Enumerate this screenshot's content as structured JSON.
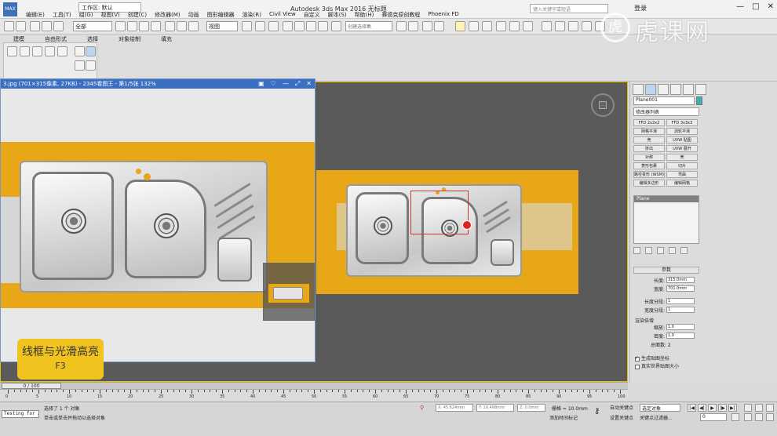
{
  "titlebar": {
    "workspace": "工作区: 默认",
    "title": "Autodesk 3ds Max 2016      无标题",
    "search_placeholder": "键入关键字或短语",
    "login": "登录",
    "menus": [
      "编辑(E)",
      "工具(T)",
      "组(G)",
      "视图(V)",
      "创建(C)",
      "修改器(M)",
      "动画",
      "图形编辑器",
      "渲染(R)",
      "Civil View",
      "自定义",
      "脚本(S)",
      "帮助(H)",
      "赛德克原创教程",
      "Phoenix FD"
    ],
    "window_buttons": [
      "—",
      "□",
      "✕"
    ],
    "app_icon_label": "MAX"
  },
  "toolbar": {
    "selection_filter": "全部",
    "reference_coord": "视图",
    "named_selection": "创建选择集"
  },
  "ribbon": {
    "tabs": [
      "建模",
      "自由形式",
      "选择",
      "对象绘制",
      "填充"
    ]
  },
  "watermark": {
    "text": "虎课网"
  },
  "image_viewer": {
    "title": "3.jpg  (701×315像素, 27KB) - 2345看图王 - 第1/5张 132%",
    "buttons": [
      "▣",
      "♡",
      "—",
      "⤢",
      "✕"
    ]
  },
  "caption": {
    "line1": "线框与光滑高亮",
    "line2": "F3"
  },
  "command_panel": {
    "object_name": "Plane001",
    "object_color": "#3ab0b8",
    "modifier_list": "修改器列表",
    "modifier_buttons": [
      [
        "FFD 2x2x2",
        "FFD 3x3x3"
      ],
      [
        "网格平滑",
        "涡轮平滑"
      ],
      [
        "壳",
        "UVW 贴图"
      ],
      [
        "挤出",
        "UVW 展开"
      ],
      [
        "对称",
        "壳"
      ],
      [
        "菱形包裹",
        "切片"
      ],
      [
        "路径变形 (WSM)",
        "弯曲"
      ],
      [
        "编辑多边形",
        "编辑网格"
      ]
    ],
    "stack_item": "Plane",
    "params_title": "参数",
    "params": [
      {
        "label": "长度:",
        "value": "315.0mm"
      },
      {
        "label": "宽度:",
        "value": "701.0mm"
      },
      {
        "label": "长度分段:",
        "value": "1"
      },
      {
        "label": "宽度分段:",
        "value": "1"
      }
    ],
    "render_title": "渲染倍增",
    "render_params": [
      {
        "label": "缩放:",
        "value": "1.0"
      },
      {
        "label": "密度:",
        "value": "1.0"
      }
    ],
    "total_faces": "总面数: 2",
    "checkbox1": "生成贴图坐标",
    "checkbox2": "真实世界贴图大小"
  },
  "timeline": {
    "slider_label": "0 / 100",
    "ticks": [
      "0",
      "5",
      "10",
      "15",
      "20",
      "25",
      "30",
      "35",
      "40",
      "45",
      "50",
      "55",
      "60",
      "65",
      "70",
      "75",
      "80",
      "85",
      "90",
      "95",
      "100"
    ]
  },
  "status": {
    "maxscript": "Testing for AU",
    "line1": "选择了 1 个 对象",
    "line2": "单击或单击并拖动以选择对象",
    "x": "X: 45.624mm",
    "y": "Y: 10.498mm",
    "z": "Z: 0.0mm",
    "grid": "栅格 = 10.0mm",
    "add_time_tag": "添加时间标记",
    "auto_key": "自动关键点",
    "set_key": "设置关键点",
    "key_select": "选定对象",
    "key_filters": "关键点过滤器...",
    "frame": "0",
    "play_controls": [
      "|◀",
      "◀|",
      "▶",
      "|▶",
      "▶|"
    ]
  }
}
